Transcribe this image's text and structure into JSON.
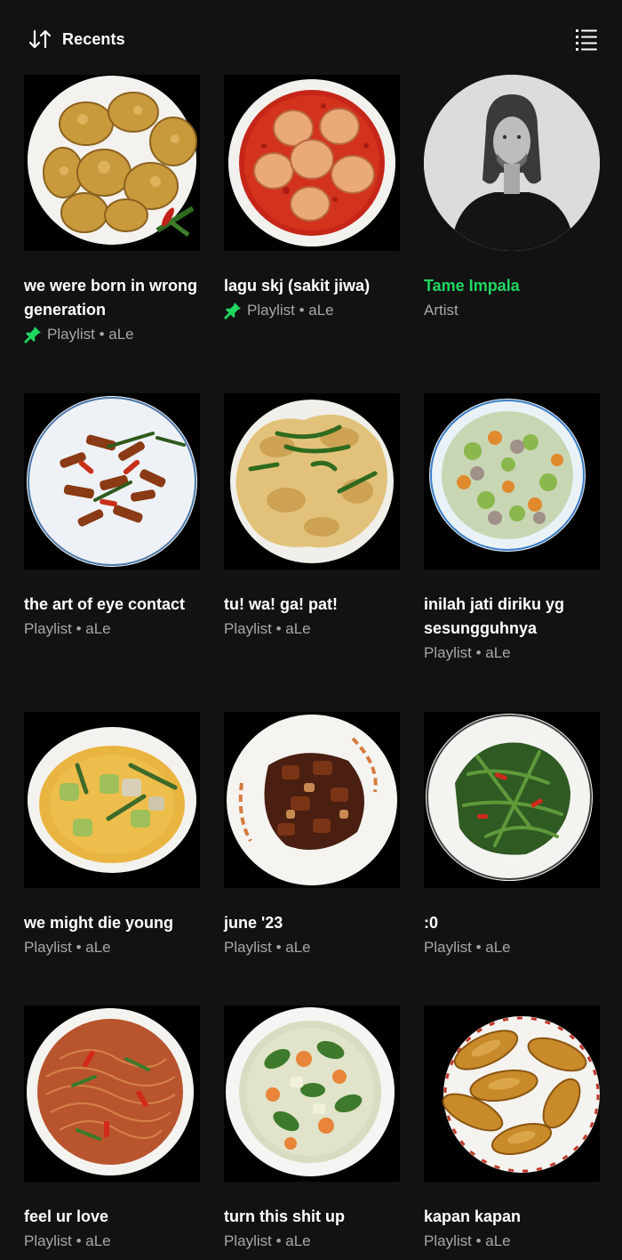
{
  "header": {
    "sort_label": "Recents",
    "sort_icon": "sort-arrows-icon",
    "view_icon": "list-view-icon"
  },
  "colors": {
    "background": "#121212",
    "accent_green": "#1ed760",
    "subtext": "#a7a7a7"
  },
  "items": [
    {
      "title": "we were born in wrong generation",
      "subtitle": "Playlist • aLe",
      "pinned": true,
      "artwork": "fried corn fritters on white plate"
    },
    {
      "title": "lagu skj (sakit jiwa)",
      "subtitle": "Playlist • aLe",
      "pinned": true,
      "artwork": "eggs in red chili sauce"
    },
    {
      "title": "Tame Impala",
      "subtitle": "Artist",
      "pinned": false,
      "artwork": "black and white artist portrait"
    },
    {
      "title": "the art of eye contact",
      "subtitle": "Playlist • aLe",
      "pinned": false,
      "artwork": "stir-fried tempeh with chili"
    },
    {
      "title": "tu! wa! ga! pat!",
      "subtitle": "Playlist • aLe",
      "pinned": false,
      "artwork": "fried omelette with green chili"
    },
    {
      "title": "inilah jati diriku yg sesungguhnya",
      "subtitle": "Playlist • aLe",
      "pinned": false,
      "artwork": "mixed vegetable stir fry"
    },
    {
      "title": "we might die young",
      "subtitle": "Playlist • aLe",
      "pinned": false,
      "artwork": "yellow vegetable curry"
    },
    {
      "title": "june '23",
      "subtitle": "Playlist • aLe",
      "pinned": false,
      "artwork": "dark fried tempeh"
    },
    {
      "title": ":0",
      "subtitle": "Playlist • aLe",
      "pinned": false,
      "artwork": "stir-fried water spinach"
    },
    {
      "title": "feel ur love",
      "subtitle": "Playlist • aLe",
      "pinned": false,
      "artwork": "fried vermicelli noodles"
    },
    {
      "title": "turn this shit up",
      "subtitle": "Playlist • aLe",
      "pinned": false,
      "artwork": "vegetable soup"
    },
    {
      "title": "kapan kapan",
      "subtitle": "Playlist • aLe",
      "pinned": false,
      "artwork": "roasted chicken drumsticks"
    }
  ]
}
